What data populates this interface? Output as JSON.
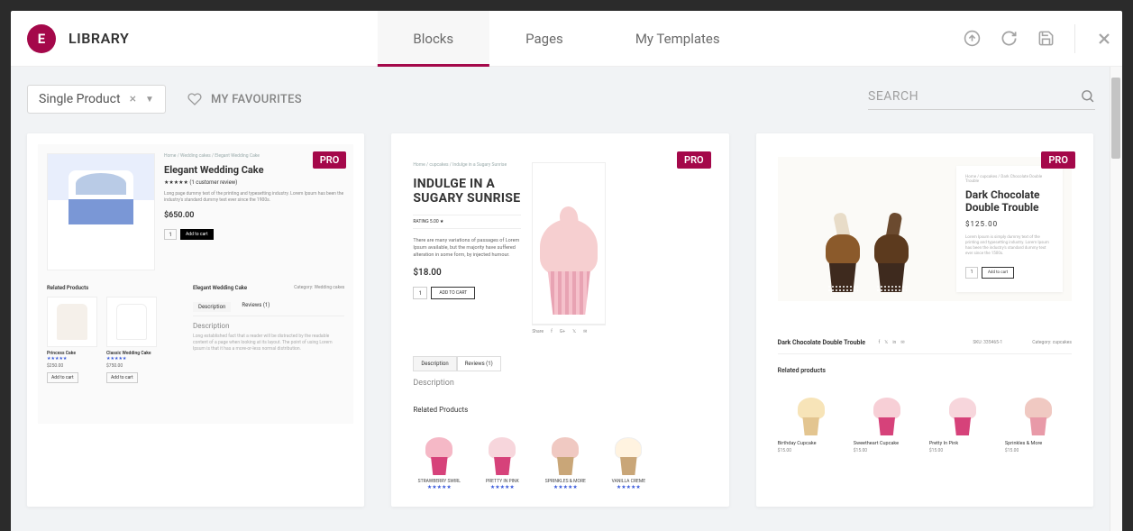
{
  "header": {
    "title": "LIBRARY",
    "logo_text": "E",
    "tabs": [
      {
        "label": "Blocks",
        "active": true
      },
      {
        "label": "Pages",
        "active": false
      },
      {
        "label": "My Templates",
        "active": false
      }
    ]
  },
  "toolbar": {
    "filter": {
      "value": "Single Product"
    },
    "favourites_label": "MY FAVOURITES",
    "search": {
      "placeholder": "SEARCH"
    }
  },
  "badge_pro": "PRO",
  "cards": [
    {
      "breadcrumb": "Home / Wedding cakes / Elegant Wedding Cake",
      "heading": "Elegant Wedding Cake",
      "reviews": "★★★★★ (1 customer review)",
      "desc": "Long page dummy text of the printing and typesetting industry. Lorem Ipsum has been the industry's standard dummy text ever since the 1900s.",
      "price": "$650.00",
      "qty": "1",
      "add_to_cart": "Add to cart",
      "related_label": "Related Products",
      "right_title": "Elegant Wedding Cake",
      "category": "Category: Wedding cakes",
      "tab_desc": "Description",
      "tab_rev": "Reviews (1)",
      "desc_h": "Description",
      "mini": [
        {
          "name": "Princess Cake",
          "price": "$250.00",
          "btn": "Add to cart"
        },
        {
          "name": "Classic Wedding Cake",
          "price": "$750.00",
          "btn": "Add to cart"
        }
      ]
    },
    {
      "breadcrumb": "Home / cupcakes / Indulge in a Sugary Sunrise",
      "heading": "INDULGE IN A SUGARY SUNRISE",
      "rating": "RATING 5.00 ★",
      "desc": "There are many variations of passages of Lorem Ipsum available, but the majority have suffered alteration in some form, by injected humour.",
      "price": "$18.00",
      "qty": "1",
      "add_to_cart": "ADD TO CART",
      "share": "Share",
      "tab_desc": "Description",
      "tab_rev": "Reviews (1)",
      "desc_h": "Description",
      "related_label": "Related Products",
      "mini": [
        {
          "name": "STRAWBERRY SWIRL"
        },
        {
          "name": "PRETTY IN PINK"
        },
        {
          "name": "SPRINKLES & MORE"
        },
        {
          "name": "VANILLA CREME"
        }
      ]
    },
    {
      "breadcrumb": "Home / cupcakes / Dark Chocolate Double Trouble",
      "heading": "Dark Chocolate Double Trouble",
      "price": "$125.00",
      "desc": "Lorem Ipsum is simply dummy text of the printing and typesetting industry. Lorem Ipsum has been the industry's standard dummy text ever since the 1500s.",
      "qty": "1",
      "add_to_cart": "Add to cart",
      "meta_title": "Dark Chocolate Double Trouble",
      "sku": "SKU: 335465-1",
      "category": "Category: cupcakes",
      "related_label": "Related products",
      "mini": [
        {
          "name": "Birthday Cupcake",
          "price": "$15.00"
        },
        {
          "name": "Sweetheart Cupcake",
          "price": "$15.00"
        },
        {
          "name": "Pretty In Pink",
          "price": "$15.00"
        },
        {
          "name": "Sprinkles & More",
          "price": "$15.00"
        }
      ]
    }
  ]
}
